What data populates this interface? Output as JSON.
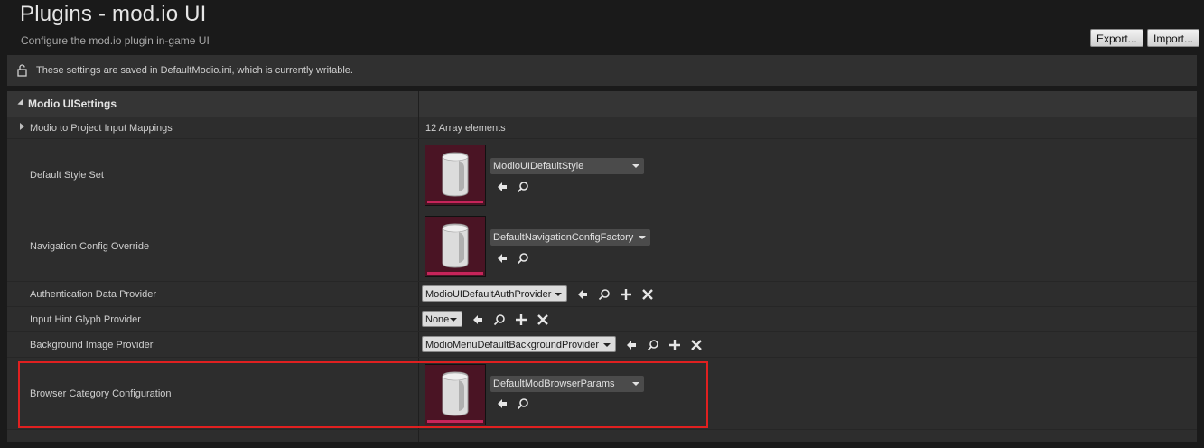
{
  "header": {
    "title": "Plugins - mod.io UI",
    "subtitle": "Configure the mod.io plugin in-game UI",
    "export_label": "Export...",
    "import_label": "Import..."
  },
  "notice": {
    "icon": "lock-open-icon",
    "text": "These settings are saved in DefaultModio.ini, which is currently writable."
  },
  "section": {
    "title": "Modio UISettings"
  },
  "rows": {
    "input_mappings": {
      "label": "Modio to Project Input Mappings",
      "value": "12 Array elements"
    },
    "default_style_set": {
      "label": "Default Style Set",
      "asset": "ModioUIDefaultStyle"
    },
    "navigation_config": {
      "label": "Navigation Config Override",
      "asset": "DefaultNavigationConfigFactory"
    },
    "auth_provider": {
      "label": "Authentication Data Provider",
      "value": "ModioUIDefaultAuthProvider"
    },
    "input_hint": {
      "label": "Input Hint Glyph Provider",
      "value": "None"
    },
    "background_image": {
      "label": "Background Image Provider",
      "value": "ModioMenuDefaultBackgroundProvider"
    },
    "browser_category": {
      "label": "Browser Category Configuration",
      "asset": "DefaultModBrowserParams"
    }
  },
  "colors": {
    "accent_pink": "#c6245a",
    "thumb_bg": "#4a1424",
    "highlight_red": "#e02020"
  }
}
